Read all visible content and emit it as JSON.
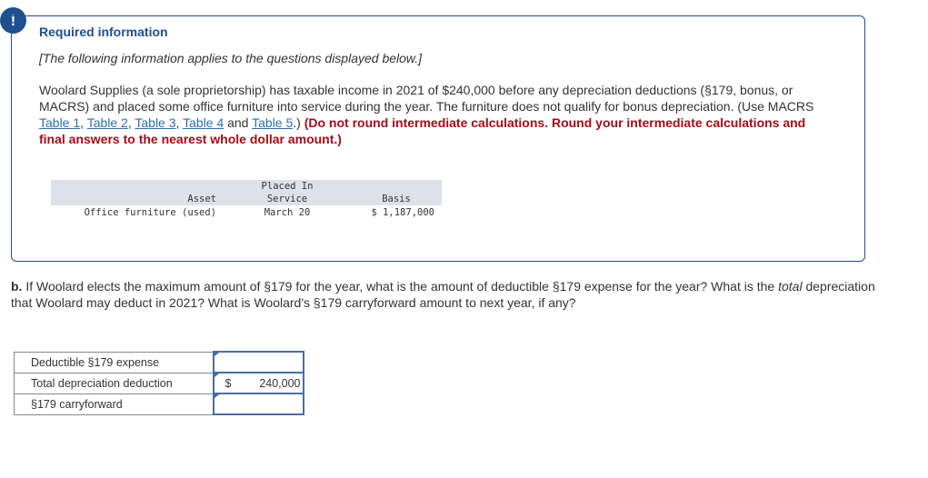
{
  "alert": {
    "icon": "exclamation-icon",
    "glyph": "!"
  },
  "required": {
    "title": "Required information",
    "intro": "[The following information applies to the questions displayed below.]",
    "problem_text_1": "Woolard Supplies (a sole proprietorship) has taxable income in 2021 of $240,000 before any depreciation deductions (§179, bonus, or MACRS) and placed some office furniture into service during the year. The furniture does not qualify for bonus depreciation. (Use MACRS ",
    "links": [
      "Table 1",
      "Table 2",
      "Table 3",
      "Table 4",
      "Table 5"
    ],
    "sep_comma": ", ",
    "sep_and": " and ",
    "after_links": ".) ",
    "instruction": "(Do not round intermediate calculations. Round your intermediate calculations and final answers to the nearest whole dollar amount.)",
    "colors": {
      "accent": "#1d4f91",
      "link": "#2e6db4",
      "instruction": "#a30d16"
    }
  },
  "asset_table": {
    "headers": {
      "asset": "Asset",
      "placed_line1": "Placed In",
      "placed_line2": "Service",
      "basis": "Basis"
    },
    "rows": [
      {
        "asset": "Office furniture (used)",
        "placed": "March 20",
        "basis": "$ 1,187,000"
      }
    ]
  },
  "question": {
    "label": "b.",
    "text_1": " If Woolard elects the maximum amount of §179 for the year, what is the amount of deductible §179 expense for the year? What is the ",
    "italic": "total",
    "text_2": " depreciation that Woolard may deduct in 2021? What is Woolard's §179 carryforward amount to next year, if any?"
  },
  "answers": [
    {
      "label": "Deductible §179 expense",
      "currency": "",
      "value": ""
    },
    {
      "label": "Total depreciation deduction",
      "currency": "$",
      "value": "240,000"
    },
    {
      "label": "§179 carryforward",
      "currency": "",
      "value": ""
    }
  ]
}
